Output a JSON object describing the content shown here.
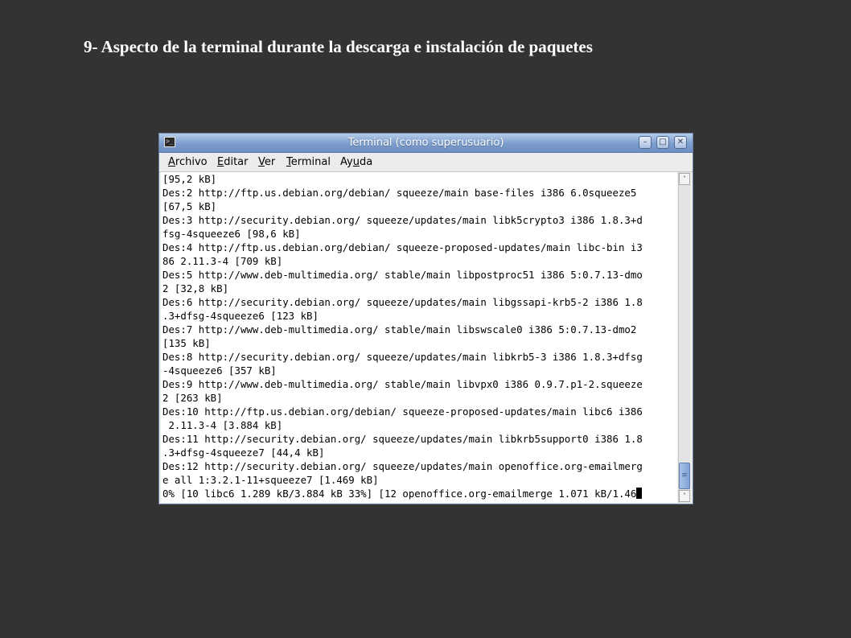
{
  "slide": {
    "heading": "9- Aspecto de la terminal durante la descarga e instalación de paquetes"
  },
  "window": {
    "title": "Terminal (como superusuario)",
    "controls": {
      "minimize": "–",
      "maximize": "□",
      "close": "✕"
    }
  },
  "menu": [
    {
      "pre": "",
      "acc": "A",
      "post": "rchivo"
    },
    {
      "pre": "",
      "acc": "E",
      "post": "ditar"
    },
    {
      "pre": "",
      "acc": "V",
      "post": "er"
    },
    {
      "pre": "",
      "acc": "T",
      "post": "erminal"
    },
    {
      "pre": "Ay",
      "acc": "u",
      "post": "da"
    }
  ],
  "terminal": {
    "lines": [
      "[95,2 kB]",
      "Des:2 http://ftp.us.debian.org/debian/ squeeze/main base-files i386 6.0squeeze5",
      "[67,5 kB]",
      "Des:3 http://security.debian.org/ squeeze/updates/main libk5crypto3 i386 1.8.3+d",
      "fsg-4squeeze6 [98,6 kB]",
      "Des:4 http://ftp.us.debian.org/debian/ squeeze-proposed-updates/main libc-bin i3",
      "86 2.11.3-4 [709 kB]",
      "Des:5 http://www.deb-multimedia.org/ stable/main libpostproc51 i386 5:0.7.13-dmo",
      "2 [32,8 kB]",
      "Des:6 http://security.debian.org/ squeeze/updates/main libgssapi-krb5-2 i386 1.8",
      ".3+dfsg-4squeeze6 [123 kB]",
      "Des:7 http://www.deb-multimedia.org/ stable/main libswscale0 i386 5:0.7.13-dmo2",
      "[135 kB]",
      "Des:8 http://security.debian.org/ squeeze/updates/main libkrb5-3 i386 1.8.3+dfsg",
      "-4squeeze6 [357 kB]",
      "Des:9 http://www.deb-multimedia.org/ stable/main libvpx0 i386 0.9.7.p1-2.squeeze",
      "2 [263 kB]",
      "Des:10 http://ftp.us.debian.org/debian/ squeeze-proposed-updates/main libc6 i386",
      " 2.11.3-4 [3.884 kB]",
      "Des:11 http://security.debian.org/ squeeze/updates/main libkrb5support0 i386 1.8",
      ".3+dfsg-4squeeze7 [44,4 kB]",
      "Des:12 http://security.debian.org/ squeeze/updates/main openoffice.org-emailmerg",
      "e all 1:3.2.1-11+squeeze7 [1.469 kB]"
    ],
    "status_line": "0% [10 libc6 1.289 kB/3.884 kB 33%] [12 openoffice.org-emailmerge 1.071 kB/1.46"
  },
  "scrollbar": {
    "up_arrow": "˄",
    "down_arrow": "˅",
    "grip": "≡"
  }
}
